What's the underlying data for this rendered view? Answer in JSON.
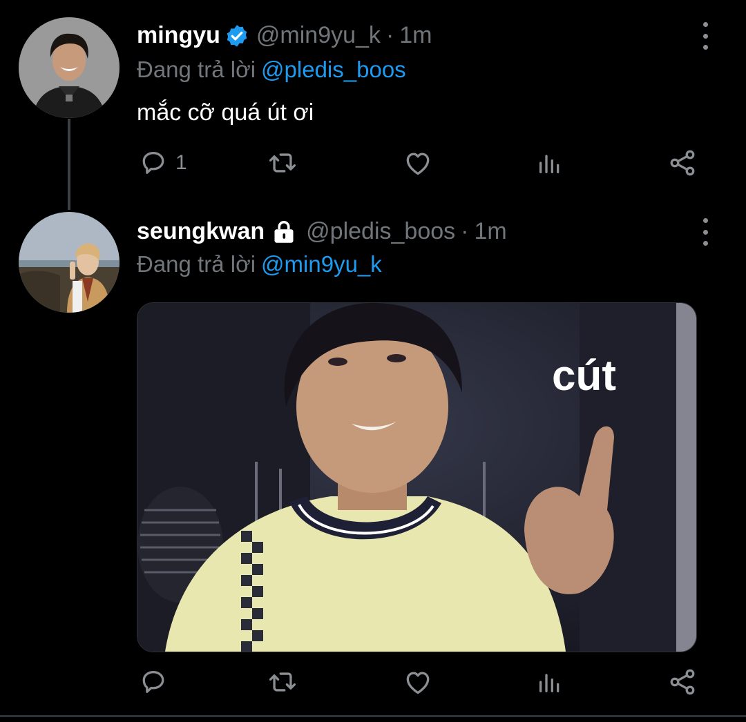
{
  "colors": {
    "background": "#000000",
    "text_primary": "#ffffff",
    "text_secondary": "#71767b",
    "accent": "#1d9bf0",
    "thread_line": "#3e4144"
  },
  "tweets": [
    {
      "display_name": "mingyu",
      "badge": "verified-badge-icon",
      "handle": "@min9yu_k",
      "separator": "·",
      "time": "1m",
      "reply_prefix": "Đang trả lời",
      "reply_to": "@pledis_boos",
      "text": "mắc cỡ quá út ơi",
      "actions": {
        "reply_count": "1",
        "retweet_count": "",
        "like_count": ""
      }
    },
    {
      "display_name": "seungkwan",
      "badge": "lock-icon",
      "handle": "@pledis_boos",
      "separator": "·",
      "time": "1m",
      "reply_prefix": "Đang trả lời",
      "reply_to": "@min9yu_k",
      "media_caption": "cút",
      "actions": {
        "reply_count": "",
        "retweet_count": "",
        "like_count": ""
      }
    }
  ],
  "icons": [
    "reply-icon",
    "retweet-icon",
    "like-icon",
    "analytics-icon",
    "share-icon",
    "more-icon"
  ]
}
